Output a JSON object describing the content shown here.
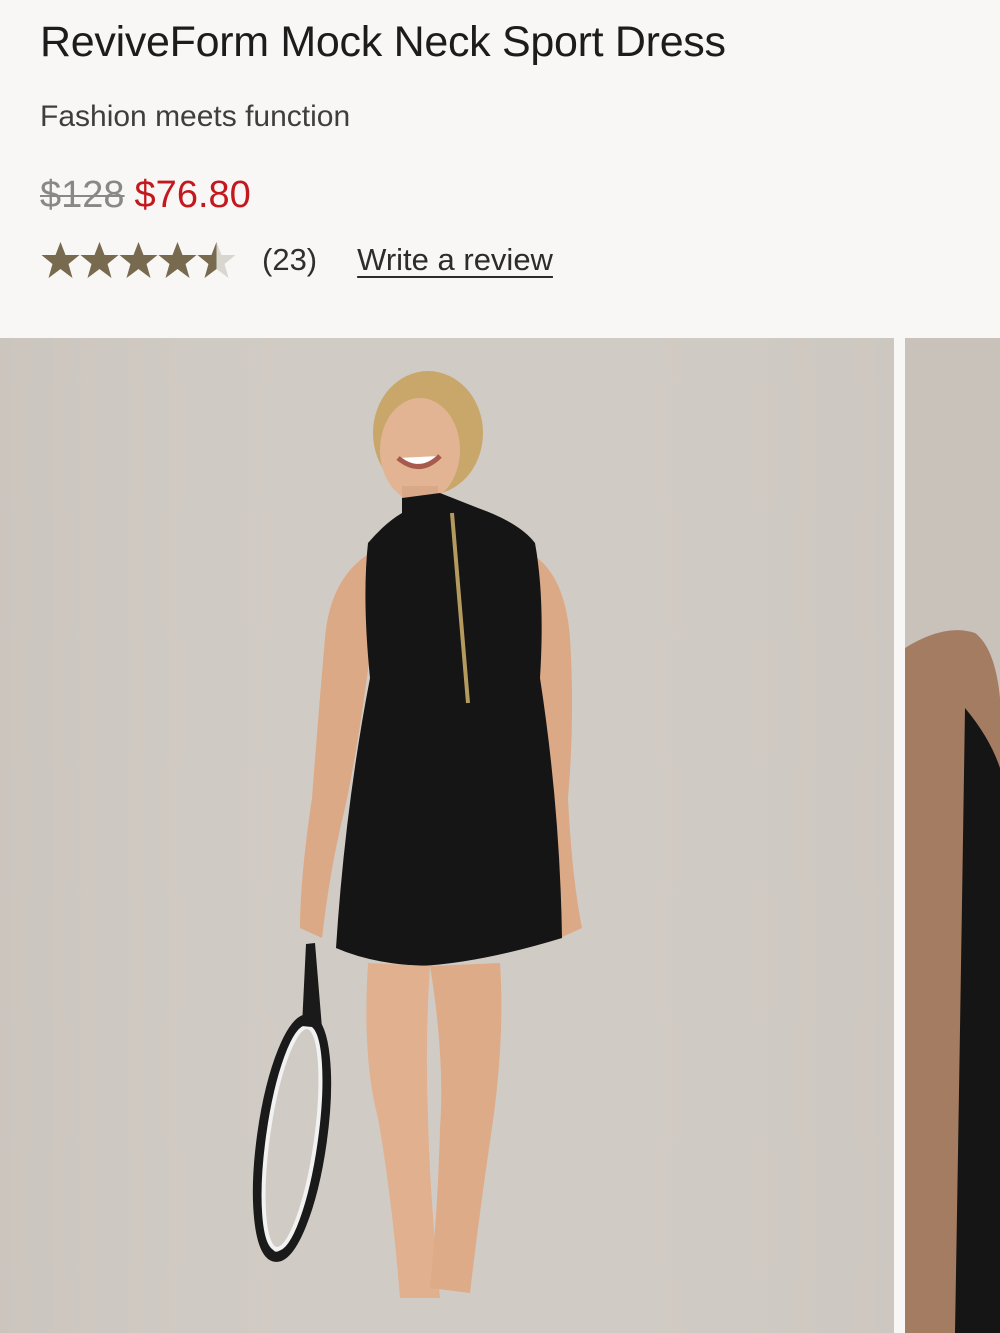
{
  "product": {
    "title": "ReviveForm Mock Neck Sport Dress",
    "tagline": "Fashion meets function",
    "price_original": "$128",
    "price_sale": "$76.80",
    "rating": 4.5,
    "review_count": "(23)",
    "write_review_label": "Write a review"
  },
  "gallery": {
    "images": [
      {
        "alt": "Woman wearing black mock neck sport dress holding a tennis racket",
        "icon": "product-photo"
      },
      {
        "alt": "Partial view of next product photo",
        "icon": "product-photo"
      }
    ]
  },
  "colors": {
    "star": "#776a4f",
    "sale_price": "#c3191e",
    "original_price": "#8a8784"
  }
}
